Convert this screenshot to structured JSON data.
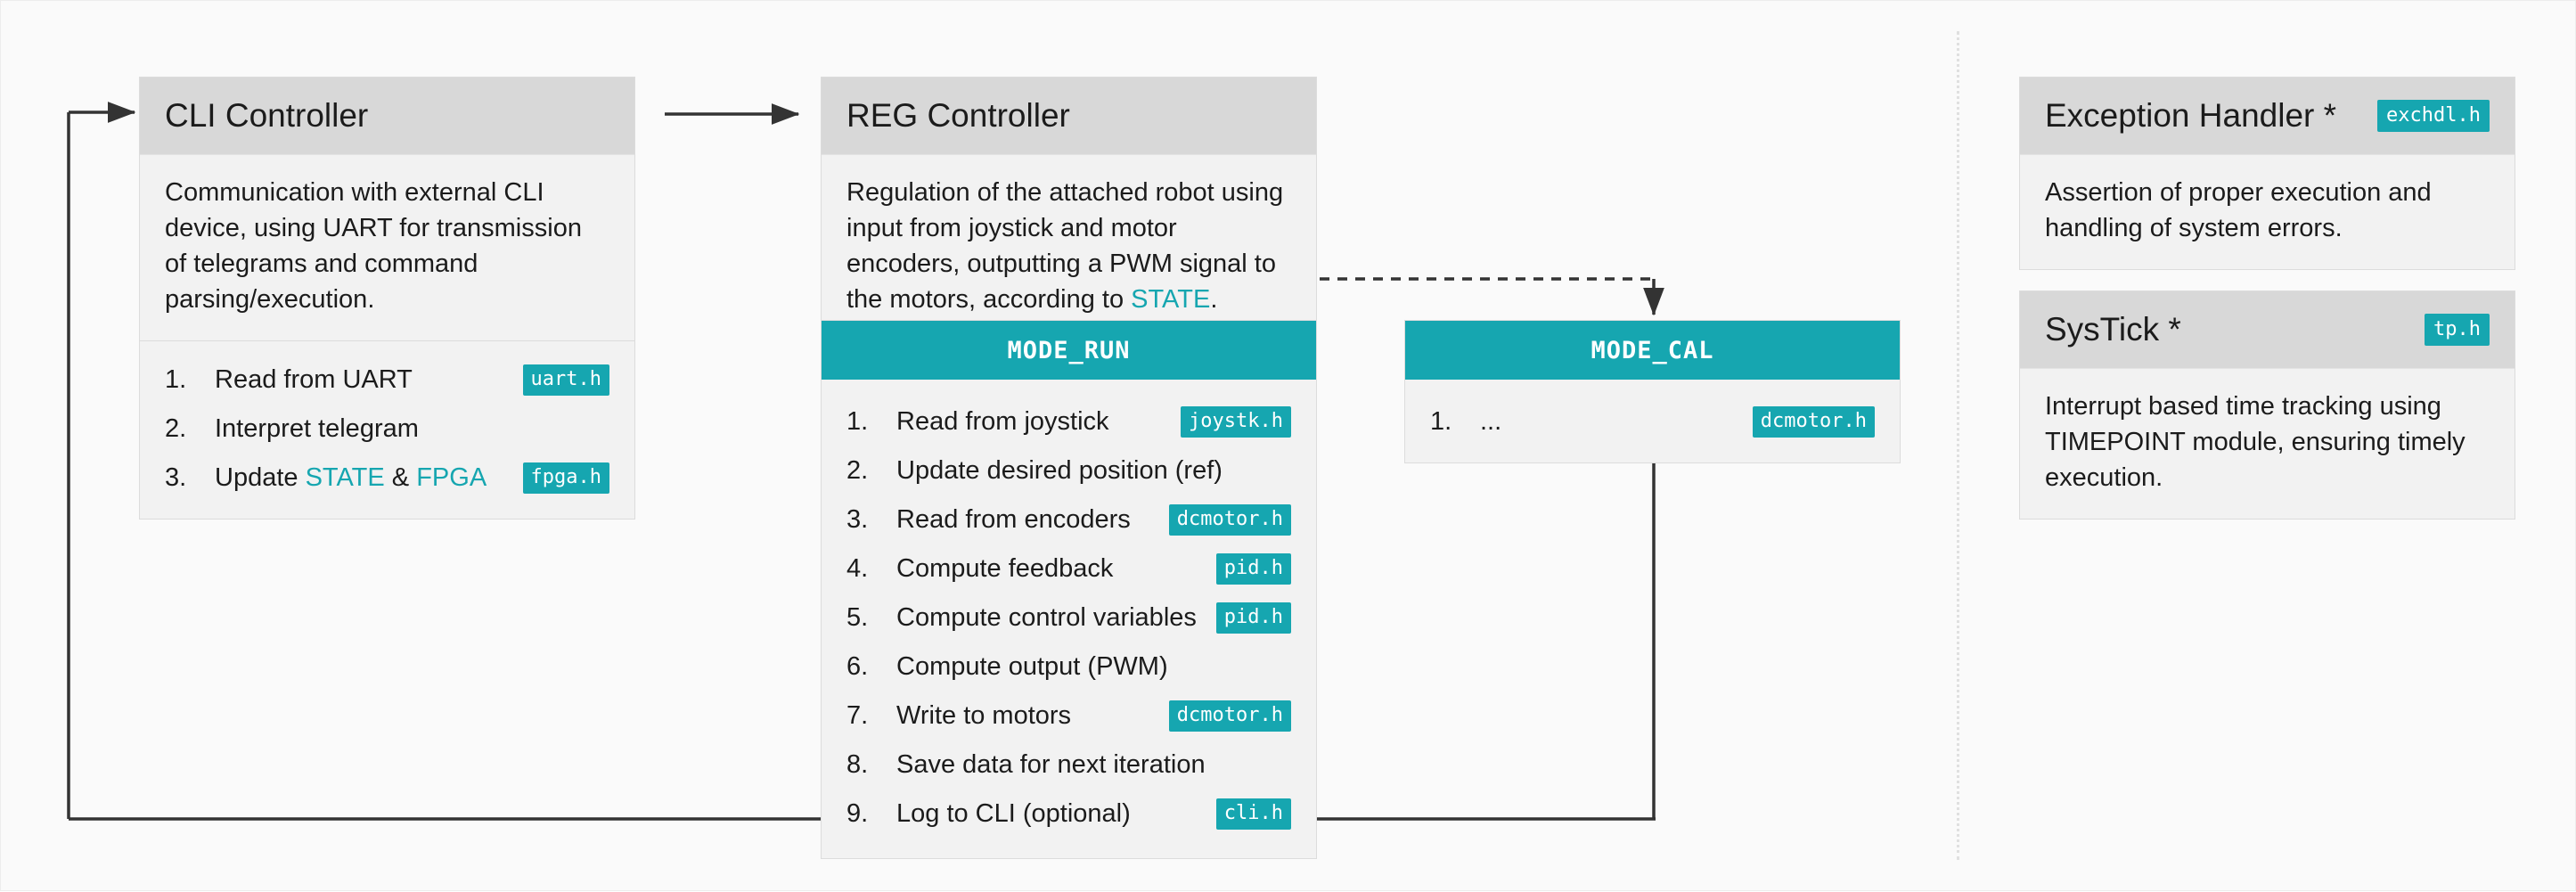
{
  "diagram": {
    "title_note": "software architecture block diagram"
  },
  "cli_controller": {
    "title": "CLI Controller",
    "description": "Communication with external CLI device, using UART for transmission of telegrams and command parsing/execution.",
    "steps": [
      {
        "num": "1.",
        "text": "Read from UART",
        "tag": "uart.h"
      },
      {
        "num": "2.",
        "text": "Interpret telegram",
        "tag": ""
      },
      {
        "num": "3.",
        "text": "Update ",
        "kw1": "STATE",
        "mid": " & ",
        "kw2": "FPGA",
        "tag": "fpga.h"
      }
    ]
  },
  "reg_controller": {
    "title": "REG Controller",
    "desc_pre": "Regulation of the attached robot using input from joystick and motor encoders, outputting a PWM signal to the motors, according to ",
    "desc_kw": "STATE",
    "desc_post": "."
  },
  "mode_run": {
    "title": "MODE_RUN",
    "steps": [
      {
        "num": "1.",
        "text": "Read from joystick",
        "tag": "joystk.h"
      },
      {
        "num": "2.",
        "text": "Update desired position (ref)",
        "tag": ""
      },
      {
        "num": "3.",
        "text": "Read from encoders",
        "tag": "dcmotor.h"
      },
      {
        "num": "4.",
        "text": "Compute feedback",
        "tag": "pid.h"
      },
      {
        "num": "5.",
        "text": "Compute control variables",
        "tag": "pid.h"
      },
      {
        "num": "6.",
        "text": "Compute output (PWM)",
        "tag": ""
      },
      {
        "num": "7.",
        "text": "Write to motors",
        "tag": "dcmotor.h"
      },
      {
        "num": "8.",
        "text": "Save data for next iteration",
        "tag": ""
      },
      {
        "num": "9.",
        "text": "Log to CLI (optional)",
        "tag": "cli.h"
      }
    ]
  },
  "mode_cal": {
    "title": "MODE_CAL",
    "steps": [
      {
        "num": "1.",
        "text": "...",
        "tag": "dcmotor.h"
      }
    ]
  },
  "exception_handler": {
    "title": "Exception Handler *",
    "tag": "exchdl.h",
    "description": "Assertion of proper execution and handling of system errors."
  },
  "systick": {
    "title": "SysTick *",
    "tag": "tp.h",
    "description": "Interrupt based time tracking using TIMEPOINT module, ensuring timely execution."
  },
  "colors": {
    "accent": "#16a6b0",
    "header_grey": "#d8d8d8",
    "body_grey": "#f2f2f2",
    "canvas": "#fafafa",
    "wire": "#333333"
  }
}
